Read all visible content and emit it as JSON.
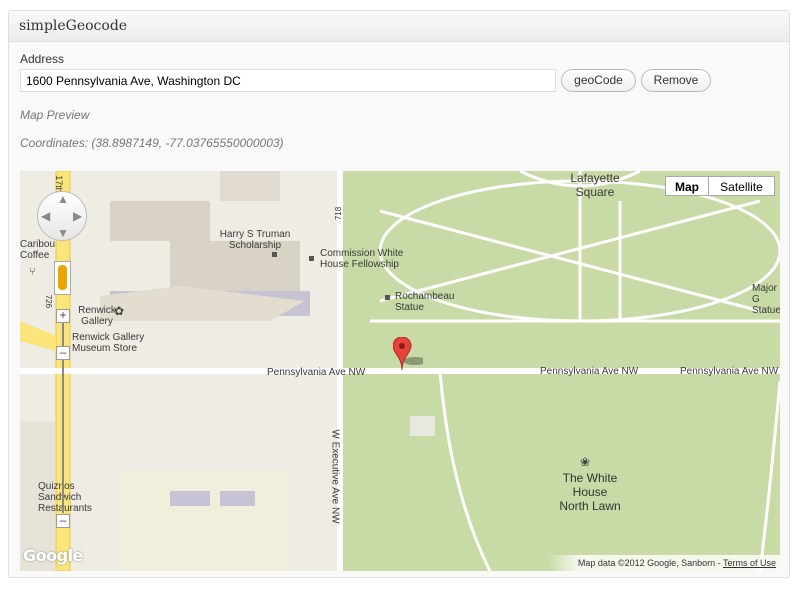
{
  "panel": {
    "title": "simpleGeocode"
  },
  "form": {
    "address_label": "Address",
    "address_value": "1600 Pennsylvania Ave, Washington DC",
    "geocode_label": "geoCode",
    "remove_label": "Remove",
    "map_preview": "Map Preview",
    "coordinates": "Coordinates: (38.8987149, -77.03765550000003)"
  },
  "map": {
    "type_map": "Map",
    "type_satellite": "Satellite",
    "labels": {
      "lafayette": "Lafayette\nSquare",
      "truman": "Harry S Truman\nScholarship",
      "commission": "Commission White\nHouse Fellowship",
      "rochambeau": "Rochambeau\nStatue",
      "caribou": "Caribou\nCoffee",
      "renwick": "Renwick\nGallery",
      "renwick_store": "Renwick Gallery\nMuseum Store",
      "penn_1": "Pennsylvania Ave NW",
      "penn_2": "Pennsylvania Ave NW",
      "penn_3": "Pennsylvania Ave NW",
      "executive": "W Executive Ave NW",
      "white_house": "The White\nHouse\nNorth Lawn",
      "quiznos": "Quiznos\nSandwich\nRestaurants",
      "major": "Major G\nStatue",
      "street_718": "718",
      "street_726": "726",
      "street_17": "17th"
    },
    "google_logo": "Google",
    "attribution": "Map data ©2012 Google, Sanborn - ",
    "terms": "Terms of Use"
  },
  "colors": {
    "park": "#c8dba6",
    "road": "#ffffff",
    "highway": "#fbe57a",
    "building": "#d9d2c6",
    "marker": "#e8443a"
  }
}
